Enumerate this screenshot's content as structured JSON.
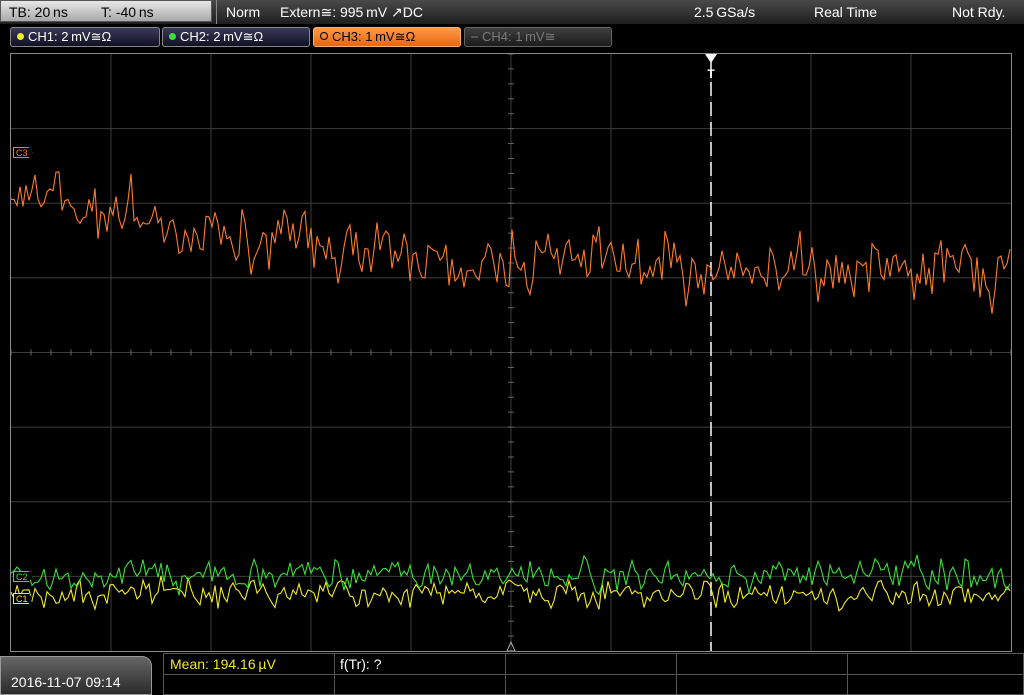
{
  "status_bar": {
    "timebase": "TB: 20 ns",
    "trigger_offset": "T: -40 ns",
    "trigger_mode": "Norm",
    "trigger_source": "Extern≅: 995 mV ↗DC",
    "sample_rate": "2.5 GSa/s",
    "acq_mode": "Real Time",
    "run_state": "Not Rdy."
  },
  "channels": [
    {
      "label": "CH1: 2 mV≅Ω",
      "color": "#f2ea2a",
      "state": "on"
    },
    {
      "label": "CH2: 2 mV≅Ω",
      "color": "#38e038",
      "state": "on"
    },
    {
      "label": "CH3: 1 mV≅Ω",
      "color": "#ff7a2a",
      "state": "active"
    },
    {
      "label": "CH4: 1 mV≅",
      "color": "#777777",
      "state": "off"
    }
  ],
  "markers": {
    "ch3": "C3",
    "ch2": "C2",
    "ch1": "C1",
    "trigger": "T"
  },
  "colors": {
    "ch1": "#f2ea2a",
    "ch2": "#38e038",
    "ch3": "#ff7a2a",
    "grid": "#3c3c3c"
  },
  "bottom_bar": {
    "datetime": "2016-11-07  09:14",
    "measurement_mean": "Mean: 194.16 µV",
    "measurement_freq": "f(Tr): ?"
  }
}
